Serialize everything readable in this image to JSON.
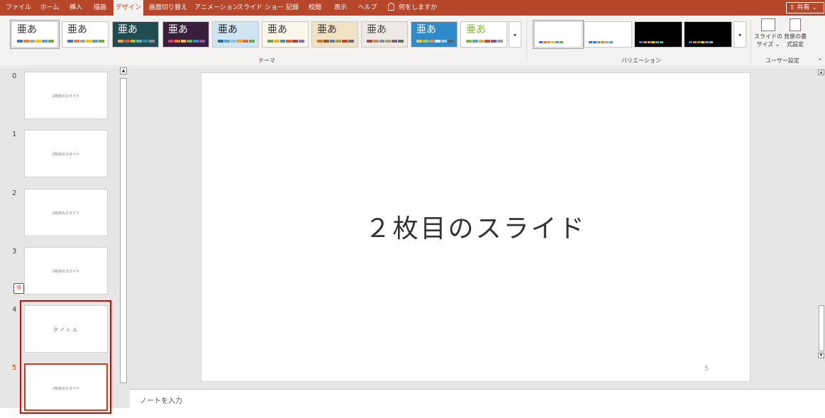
{
  "ribbon": {
    "tabs": [
      {
        "label": "ファイル"
      },
      {
        "label": "ホーム"
      },
      {
        "label": "挿入"
      },
      {
        "label": "描画"
      },
      {
        "label": "デザイン"
      },
      {
        "label": "画面切り替え"
      },
      {
        "label": "アニメーション"
      },
      {
        "label": "スライド ショー"
      },
      {
        "label": "記録"
      },
      {
        "label": "校閲"
      },
      {
        "label": "表示"
      },
      {
        "label": "ヘルプ"
      }
    ],
    "active_tab": "デザイン",
    "tell_me": "何をしますか",
    "share": "共有",
    "themes": [
      {
        "glyph": "亜あ",
        "bg": "#ffffff",
        "fg": "#333333",
        "swatches": [
          "#4472c4",
          "#ed7d31",
          "#a5a5a5",
          "#ffc000",
          "#5b9bd5",
          "#70ad47"
        ]
      },
      {
        "glyph": "亜あ",
        "bg": "#ffffff",
        "fg": "#333333",
        "swatches": [
          "#4472c4",
          "#ed7d31",
          "#a5a5a5",
          "#ffc000",
          "#5b9bd5",
          "#70ad47"
        ]
      },
      {
        "glyph": "亜あ",
        "bg": "#1f4d52",
        "fg": "#ffffff",
        "swatches": [
          "#f4a14a",
          "#e05a2b",
          "#a4c23f",
          "#5fb0cc",
          "#2e88a8",
          "#8f8f8f"
        ]
      },
      {
        "glyph": "亜あ",
        "bg": "#3a1f3d",
        "fg": "#ffffff",
        "swatches": [
          "#d4357a",
          "#e97b2a",
          "#f5c12e",
          "#6cb249",
          "#2f8fd1",
          "#8a58a6"
        ]
      },
      {
        "glyph": "亜あ",
        "bg": "#cfe6f2",
        "fg": "#222222",
        "swatches": [
          "#2c6fa6",
          "#55a0d4",
          "#82c2e4",
          "#f29e38",
          "#e36a35",
          "#6aa945"
        ]
      },
      {
        "glyph": "亜あ",
        "bg": "#fbf6ea",
        "fg": "#333333",
        "swatches": [
          "#6fa245",
          "#e4b330",
          "#3f8ec0",
          "#d3642d",
          "#b43b3b",
          "#8b6fb2"
        ]
      },
      {
        "glyph": "亜あ",
        "bg": "#f2e1c2",
        "fg": "#333333",
        "swatches": [
          "#c3772b",
          "#8c5a2a",
          "#4f7fae",
          "#9ba33a",
          "#c43b3b",
          "#6b6b6b"
        ]
      },
      {
        "glyph": "亜あ",
        "bg": "#efe9e6",
        "fg": "#444444",
        "swatches": [
          "#a14a4a",
          "#c28a5b",
          "#7f8e9a",
          "#a3a06a",
          "#775f8d",
          "#5e6f5d"
        ]
      },
      {
        "glyph": "亜あ",
        "bg": "#2e8ac9",
        "fg": "#ffffff",
        "swatches": [
          "#f0c93a",
          "#9bd25a",
          "#f28e3c",
          "#e6e6e6",
          "#8dd0f5",
          "#5e5e5e"
        ]
      },
      {
        "glyph": "亜あ",
        "bg": "#ffffff",
        "fg": "#7dbb3c",
        "swatches": [
          "#7dbb3c",
          "#4fa3c9",
          "#f0a23a",
          "#d9482c",
          "#7c5aa6",
          "#9a9a9a"
        ]
      }
    ],
    "theme_group_label": "テーマ",
    "variants": [
      {
        "bg": "#ffffff",
        "swatches": [
          "#4472c4",
          "#ed7d31",
          "#a5a5a5",
          "#ffc000",
          "#5b9bd5",
          "#70ad47"
        ]
      },
      {
        "bg": "#ffffff",
        "swatches": [
          "#4472c4",
          "#4472c4",
          "#70ad47",
          "#ed7d31",
          "#a5a5a5",
          "#5b9bd5"
        ]
      },
      {
        "bg": "#000000",
        "swatches": [
          "#4472c4",
          "#ed7d31",
          "#a5a5a5",
          "#ffc000",
          "#5b9bd5",
          "#70ad47"
        ]
      },
      {
        "bg": "#000000",
        "swatches": [
          "#4472c4",
          "#ed7d31",
          "#70ad47",
          "#ffc000",
          "#5b9bd5",
          "#a5a5a5"
        ]
      }
    ],
    "variation_group_label": "バリエーション",
    "slide_size_label": [
      "スライドの",
      "サイズ ⌄"
    ],
    "format_bg_label": [
      "背景の書",
      "式設定"
    ],
    "user_group_label": "ユーザー設定",
    "more_icon": "chevron-down-icon"
  },
  "thumbnails": [
    {
      "number": "0",
      "text": "2枚目のスライド"
    },
    {
      "number": "1",
      "text": "2枚目のスライド"
    },
    {
      "number": "2",
      "text": "2枚目のスライド"
    },
    {
      "number": "3",
      "text": "2枚目のスライド"
    },
    {
      "number": "4",
      "text": "タイトル"
    },
    {
      "number": "5",
      "text": "2枚目のスライド",
      "active": true
    }
  ],
  "badge": "⑱",
  "slide": {
    "title": "２枚目のスライド",
    "page_number": "5"
  },
  "notes": {
    "placeholder": "ノートを入力"
  }
}
